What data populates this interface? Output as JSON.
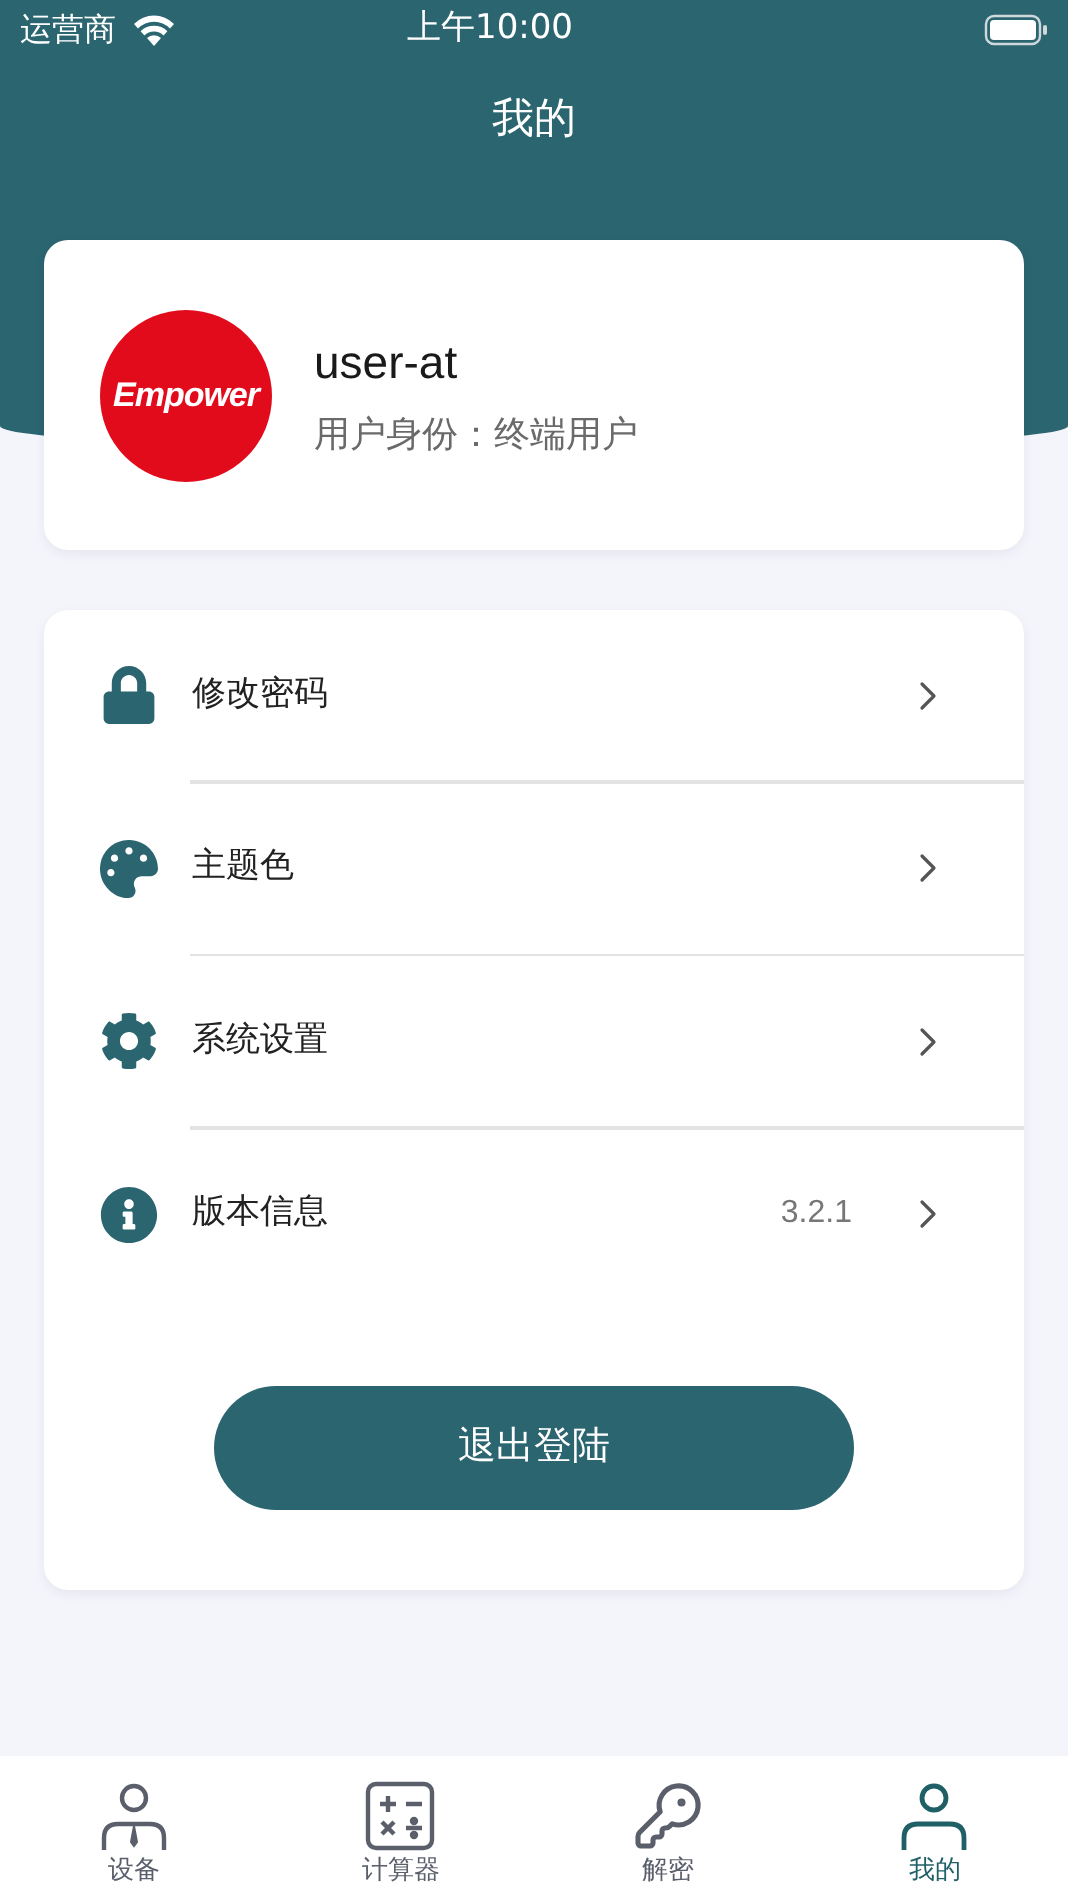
{
  "status_bar": {
    "carrier": "运营商",
    "time": "上午10:00"
  },
  "header": {
    "title": "我的"
  },
  "profile": {
    "logo_text": "Empower",
    "username": "user-at",
    "role": "用户身份：终端用户"
  },
  "menu": [
    {
      "kind": "lock",
      "label": "修改密码"
    },
    {
      "kind": "palette",
      "label": "主题色"
    },
    {
      "kind": "gear",
      "label": "系统设置"
    },
    {
      "kind": "info",
      "label": "版本信息",
      "value": "3.2.1"
    }
  ],
  "logout_button": "退出登陆",
  "tab_bar": [
    {
      "kind": "device",
      "label": "设备",
      "selected": false
    },
    {
      "kind": "calculator",
      "label": "计算器",
      "selected": false
    },
    {
      "kind": "decrypt",
      "label": "解密",
      "selected": false
    },
    {
      "kind": "profile",
      "label": "我的",
      "selected": true
    }
  ]
}
